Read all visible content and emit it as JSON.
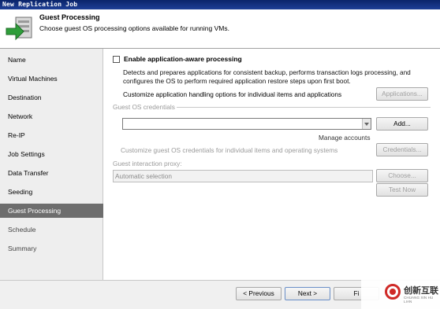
{
  "window": {
    "title": "New Replication Job"
  },
  "header": {
    "title": "Guest Processing",
    "description": "Choose guest OS processing options available for running VMs."
  },
  "sidebar": {
    "items": [
      {
        "label": "Name"
      },
      {
        "label": "Virtual Machines"
      },
      {
        "label": "Destination"
      },
      {
        "label": "Network"
      },
      {
        "label": "Re-IP"
      },
      {
        "label": "Job Settings"
      },
      {
        "label": "Data Transfer"
      },
      {
        "label": "Seeding"
      },
      {
        "label": "Guest Processing"
      },
      {
        "label": "Schedule"
      },
      {
        "label": "Summary"
      }
    ],
    "active_index": 8
  },
  "main": {
    "app_aware": {
      "label": "Enable application-aware processing",
      "checked": false,
      "description": "Detects and prepares applications for consistent backup, performs transaction logs processing, and configures the OS to perform required application restore steps upon first boot.",
      "customize_text": "Customize application handling options for individual items and applications",
      "applications_button": "Applications..."
    },
    "credentials": {
      "group_label": "Guest OS credentials",
      "value": "",
      "add_button": "Add...",
      "manage_link": "Manage accounts",
      "customize_text": "Customize guest OS credentials for individual items and operating systems",
      "credentials_button": "Credentials..."
    },
    "proxy": {
      "label": "Guest interaction proxy:",
      "value": "Automatic selection",
      "choose_button": "Choose...",
      "test_button": "Test Now"
    }
  },
  "footer": {
    "previous_button": "< Previous",
    "next_button": "Next >",
    "finish_button": "Fi"
  },
  "watermark": {
    "text": "创新互联",
    "sub": "CHUANG XIN HU LIAN"
  }
}
